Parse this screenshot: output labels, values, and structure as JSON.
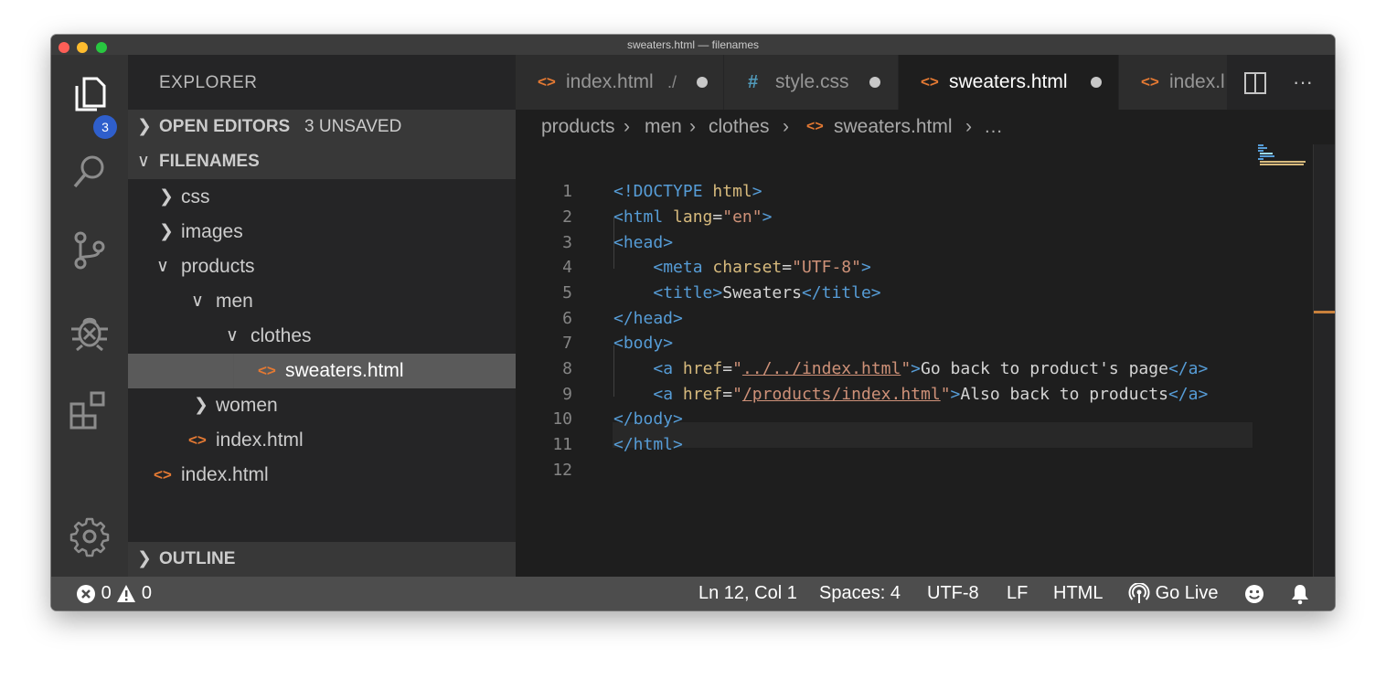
{
  "window": {
    "title": "sweaters.html — filenames",
    "traffic_lights": [
      "#fe5f57",
      "#febc2e",
      "#28c840"
    ]
  },
  "activity_bar": {
    "items": [
      "files-icon",
      "search-icon",
      "source-control-icon",
      "debug-icon",
      "extensions-icon"
    ],
    "explorer_badge": "3",
    "bottom": "gear-icon"
  },
  "sidebar": {
    "title": "EXPLORER",
    "open_editors": {
      "label": "OPEN EDITORS",
      "status": "3 UNSAVED"
    },
    "folder": {
      "label": "FILENAMES"
    },
    "tree": [
      {
        "name": "css",
        "type": "folder"
      },
      {
        "name": "images",
        "type": "folder"
      },
      {
        "name": "products",
        "type": "folder"
      },
      {
        "name": "men",
        "type": "folder"
      },
      {
        "name": "clothes",
        "type": "folder"
      },
      {
        "name": "sweaters.html",
        "type": "file"
      },
      {
        "name": "women",
        "type": "folder"
      },
      {
        "name": "index.html",
        "type": "file"
      },
      {
        "name": "index.html",
        "type": "file"
      }
    ],
    "outline": {
      "label": "OUTLINE"
    }
  },
  "tabs": [
    {
      "icon": "<>",
      "name": "index.html",
      "description": "./",
      "dirty": true
    },
    {
      "icon": "#",
      "name": "style.css",
      "description": "",
      "dirty": true
    },
    {
      "icon": "<>",
      "name": "sweaters.html",
      "description": "",
      "dirty": true,
      "active": true
    },
    {
      "icon": "<>",
      "name": "index.l",
      "description": ""
    }
  ],
  "tab_actions": {
    "split": "split-editor-icon",
    "more": "···"
  },
  "breadcrumbs": [
    "products",
    "men",
    "clothes",
    "sweaters.html",
    "…"
  ],
  "editor": {
    "line_numbers": [
      "1",
      "2",
      "3",
      "4",
      "5",
      "6",
      "7",
      "8",
      "9",
      "10",
      "11",
      "12"
    ],
    "lines": [
      "<!DOCTYPE html>",
      "<html lang=\"en\">",
      "<head>",
      "    <meta charset=\"UTF-8\">",
      "    <title>Sweaters</title>",
      "</head>",
      "<body>",
      "    <a href=\"../../index.html\">Go back to product's page</a>",
      "    <a href=\"/products/index.html\">Also back to products</a>",
      "</body>",
      "</html>",
      ""
    ],
    "colors": {
      "tag": "#569cd6",
      "attr": "#9cdcfe",
      "string": "#ce9178",
      "text": "#d4d4d4"
    }
  },
  "status_bar": {
    "errors": "0",
    "warnings": "0",
    "position": "Ln 12, Col 1",
    "spaces": "Spaces: 4",
    "encoding": "UTF-8",
    "eol": "LF",
    "language": "HTML",
    "go_live": "Go Live"
  }
}
